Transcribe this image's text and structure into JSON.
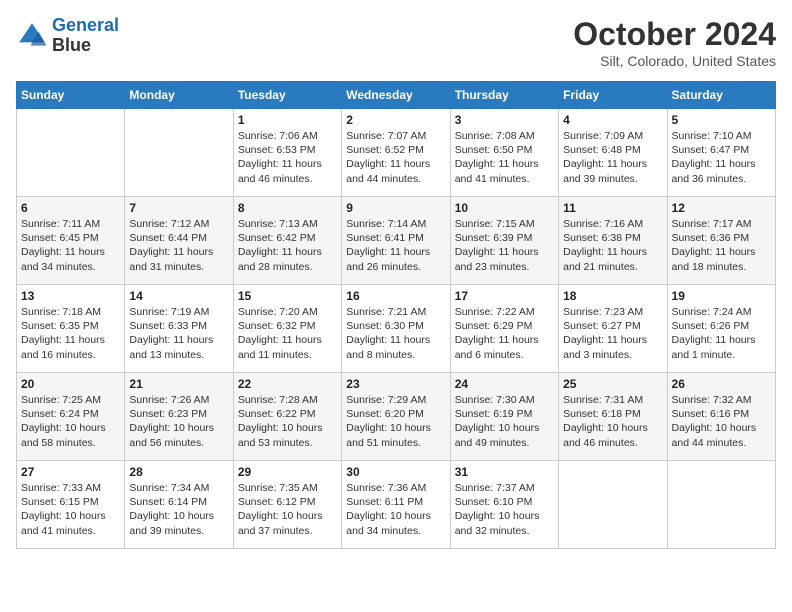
{
  "header": {
    "logo_line1": "General",
    "logo_line2": "Blue",
    "month_title": "October 2024",
    "location": "Silt, Colorado, United States"
  },
  "weekdays": [
    "Sunday",
    "Monday",
    "Tuesday",
    "Wednesday",
    "Thursday",
    "Friday",
    "Saturday"
  ],
  "weeks": [
    [
      {
        "day": "",
        "sunrise": "",
        "sunset": "",
        "daylight": ""
      },
      {
        "day": "",
        "sunrise": "",
        "sunset": "",
        "daylight": ""
      },
      {
        "day": "1",
        "sunrise": "Sunrise: 7:06 AM",
        "sunset": "Sunset: 6:53 PM",
        "daylight": "Daylight: 11 hours and 46 minutes."
      },
      {
        "day": "2",
        "sunrise": "Sunrise: 7:07 AM",
        "sunset": "Sunset: 6:52 PM",
        "daylight": "Daylight: 11 hours and 44 minutes."
      },
      {
        "day": "3",
        "sunrise": "Sunrise: 7:08 AM",
        "sunset": "Sunset: 6:50 PM",
        "daylight": "Daylight: 11 hours and 41 minutes."
      },
      {
        "day": "4",
        "sunrise": "Sunrise: 7:09 AM",
        "sunset": "Sunset: 6:48 PM",
        "daylight": "Daylight: 11 hours and 39 minutes."
      },
      {
        "day": "5",
        "sunrise": "Sunrise: 7:10 AM",
        "sunset": "Sunset: 6:47 PM",
        "daylight": "Daylight: 11 hours and 36 minutes."
      }
    ],
    [
      {
        "day": "6",
        "sunrise": "Sunrise: 7:11 AM",
        "sunset": "Sunset: 6:45 PM",
        "daylight": "Daylight: 11 hours and 34 minutes."
      },
      {
        "day": "7",
        "sunrise": "Sunrise: 7:12 AM",
        "sunset": "Sunset: 6:44 PM",
        "daylight": "Daylight: 11 hours and 31 minutes."
      },
      {
        "day": "8",
        "sunrise": "Sunrise: 7:13 AM",
        "sunset": "Sunset: 6:42 PM",
        "daylight": "Daylight: 11 hours and 28 minutes."
      },
      {
        "day": "9",
        "sunrise": "Sunrise: 7:14 AM",
        "sunset": "Sunset: 6:41 PM",
        "daylight": "Daylight: 11 hours and 26 minutes."
      },
      {
        "day": "10",
        "sunrise": "Sunrise: 7:15 AM",
        "sunset": "Sunset: 6:39 PM",
        "daylight": "Daylight: 11 hours and 23 minutes."
      },
      {
        "day": "11",
        "sunrise": "Sunrise: 7:16 AM",
        "sunset": "Sunset: 6:38 PM",
        "daylight": "Daylight: 11 hours and 21 minutes."
      },
      {
        "day": "12",
        "sunrise": "Sunrise: 7:17 AM",
        "sunset": "Sunset: 6:36 PM",
        "daylight": "Daylight: 11 hours and 18 minutes."
      }
    ],
    [
      {
        "day": "13",
        "sunrise": "Sunrise: 7:18 AM",
        "sunset": "Sunset: 6:35 PM",
        "daylight": "Daylight: 11 hours and 16 minutes."
      },
      {
        "day": "14",
        "sunrise": "Sunrise: 7:19 AM",
        "sunset": "Sunset: 6:33 PM",
        "daylight": "Daylight: 11 hours and 13 minutes."
      },
      {
        "day": "15",
        "sunrise": "Sunrise: 7:20 AM",
        "sunset": "Sunset: 6:32 PM",
        "daylight": "Daylight: 11 hours and 11 minutes."
      },
      {
        "day": "16",
        "sunrise": "Sunrise: 7:21 AM",
        "sunset": "Sunset: 6:30 PM",
        "daylight": "Daylight: 11 hours and 8 minutes."
      },
      {
        "day": "17",
        "sunrise": "Sunrise: 7:22 AM",
        "sunset": "Sunset: 6:29 PM",
        "daylight": "Daylight: 11 hours and 6 minutes."
      },
      {
        "day": "18",
        "sunrise": "Sunrise: 7:23 AM",
        "sunset": "Sunset: 6:27 PM",
        "daylight": "Daylight: 11 hours and 3 minutes."
      },
      {
        "day": "19",
        "sunrise": "Sunrise: 7:24 AM",
        "sunset": "Sunset: 6:26 PM",
        "daylight": "Daylight: 11 hours and 1 minute."
      }
    ],
    [
      {
        "day": "20",
        "sunrise": "Sunrise: 7:25 AM",
        "sunset": "Sunset: 6:24 PM",
        "daylight": "Daylight: 10 hours and 58 minutes."
      },
      {
        "day": "21",
        "sunrise": "Sunrise: 7:26 AM",
        "sunset": "Sunset: 6:23 PM",
        "daylight": "Daylight: 10 hours and 56 minutes."
      },
      {
        "day": "22",
        "sunrise": "Sunrise: 7:28 AM",
        "sunset": "Sunset: 6:22 PM",
        "daylight": "Daylight: 10 hours and 53 minutes."
      },
      {
        "day": "23",
        "sunrise": "Sunrise: 7:29 AM",
        "sunset": "Sunset: 6:20 PM",
        "daylight": "Daylight: 10 hours and 51 minutes."
      },
      {
        "day": "24",
        "sunrise": "Sunrise: 7:30 AM",
        "sunset": "Sunset: 6:19 PM",
        "daylight": "Daylight: 10 hours and 49 minutes."
      },
      {
        "day": "25",
        "sunrise": "Sunrise: 7:31 AM",
        "sunset": "Sunset: 6:18 PM",
        "daylight": "Daylight: 10 hours and 46 minutes."
      },
      {
        "day": "26",
        "sunrise": "Sunrise: 7:32 AM",
        "sunset": "Sunset: 6:16 PM",
        "daylight": "Daylight: 10 hours and 44 minutes."
      }
    ],
    [
      {
        "day": "27",
        "sunrise": "Sunrise: 7:33 AM",
        "sunset": "Sunset: 6:15 PM",
        "daylight": "Daylight: 10 hours and 41 minutes."
      },
      {
        "day": "28",
        "sunrise": "Sunrise: 7:34 AM",
        "sunset": "Sunset: 6:14 PM",
        "daylight": "Daylight: 10 hours and 39 minutes."
      },
      {
        "day": "29",
        "sunrise": "Sunrise: 7:35 AM",
        "sunset": "Sunset: 6:12 PM",
        "daylight": "Daylight: 10 hours and 37 minutes."
      },
      {
        "day": "30",
        "sunrise": "Sunrise: 7:36 AM",
        "sunset": "Sunset: 6:11 PM",
        "daylight": "Daylight: 10 hours and 34 minutes."
      },
      {
        "day": "31",
        "sunrise": "Sunrise: 7:37 AM",
        "sunset": "Sunset: 6:10 PM",
        "daylight": "Daylight: 10 hours and 32 minutes."
      },
      {
        "day": "",
        "sunrise": "",
        "sunset": "",
        "daylight": ""
      },
      {
        "day": "",
        "sunrise": "",
        "sunset": "",
        "daylight": ""
      }
    ]
  ]
}
